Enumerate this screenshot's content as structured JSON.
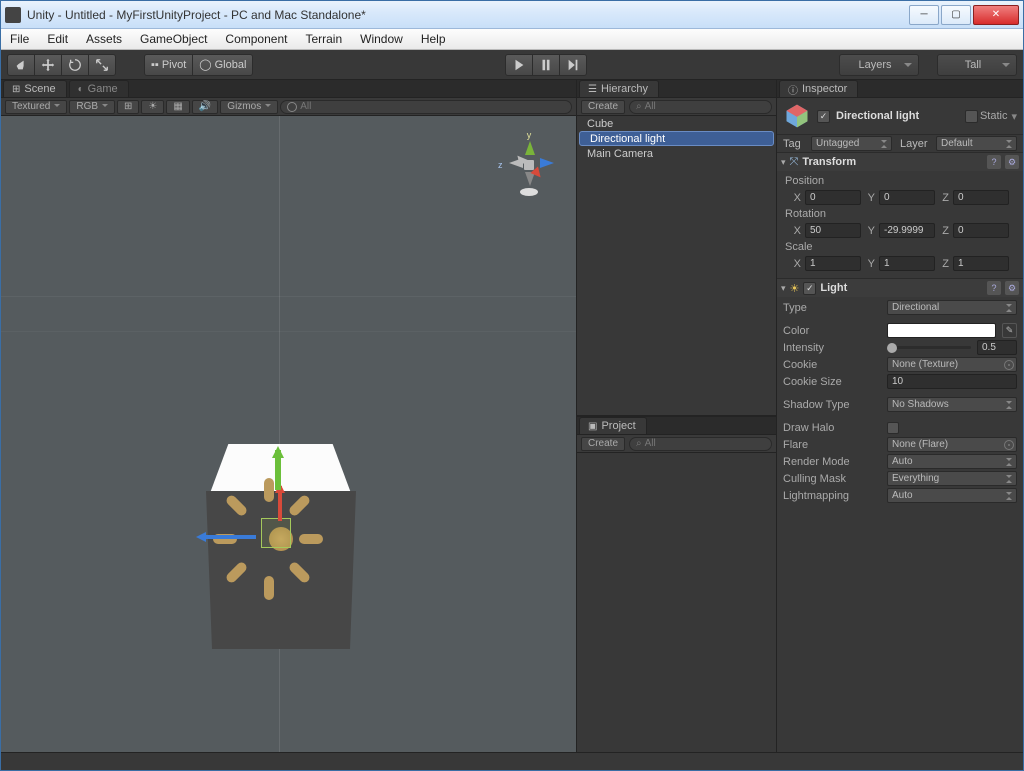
{
  "window": {
    "title": "Unity - Untitled - MyFirstUnityProject - PC and Mac Standalone*"
  },
  "menu": [
    "File",
    "Edit",
    "Assets",
    "GameObject",
    "Component",
    "Terrain",
    "Window",
    "Help"
  ],
  "toolbar": {
    "pivot": "Pivot",
    "global": "Global",
    "layers": "Layers",
    "layout": "Tall"
  },
  "scene": {
    "tab_scene": "Scene",
    "tab_game": "Game",
    "shading": "Textured",
    "render": "RGB",
    "gizmos": "Gizmos",
    "search_placeholder": "All",
    "axis_y": "y",
    "axis_z": "z"
  },
  "hierarchy": {
    "title": "Hierarchy",
    "create": "Create",
    "search_placeholder": "All",
    "items": [
      "Cube",
      "Directional light",
      "Main Camera"
    ],
    "selected": 1
  },
  "project": {
    "title": "Project",
    "create": "Create",
    "search_placeholder": "All"
  },
  "inspector": {
    "title": "Inspector",
    "object_name": "Directional light",
    "static": "Static",
    "enabled": true,
    "tag_label": "Tag",
    "tag": "Untagged",
    "layer_label": "Layer",
    "layer": "Default",
    "transform": {
      "title": "Transform",
      "position_label": "Position",
      "rotation_label": "Rotation",
      "scale_label": "Scale",
      "position": {
        "x": "0",
        "y": "0",
        "z": "0"
      },
      "rotation": {
        "x": "50",
        "y": "-29.9999",
        "z": "0"
      },
      "scale": {
        "x": "1",
        "y": "1",
        "z": "1"
      }
    },
    "light": {
      "title": "Light",
      "type_label": "Type",
      "type": "Directional",
      "color_label": "Color",
      "color": "#ffffff",
      "intensity_label": "Intensity",
      "intensity": "0.5",
      "cookie_label": "Cookie",
      "cookie": "None (Texture)",
      "cookie_size_label": "Cookie Size",
      "cookie_size": "10",
      "shadow_label": "Shadow Type",
      "shadow": "No Shadows",
      "draw_halo_label": "Draw Halo",
      "draw_halo": false,
      "flare_label": "Flare",
      "flare": "None (Flare)",
      "render_mode_label": "Render Mode",
      "render_mode": "Auto",
      "culling_label": "Culling Mask",
      "culling": "Everything",
      "lightmapping_label": "Lightmapping",
      "lightmapping": "Auto"
    }
  }
}
